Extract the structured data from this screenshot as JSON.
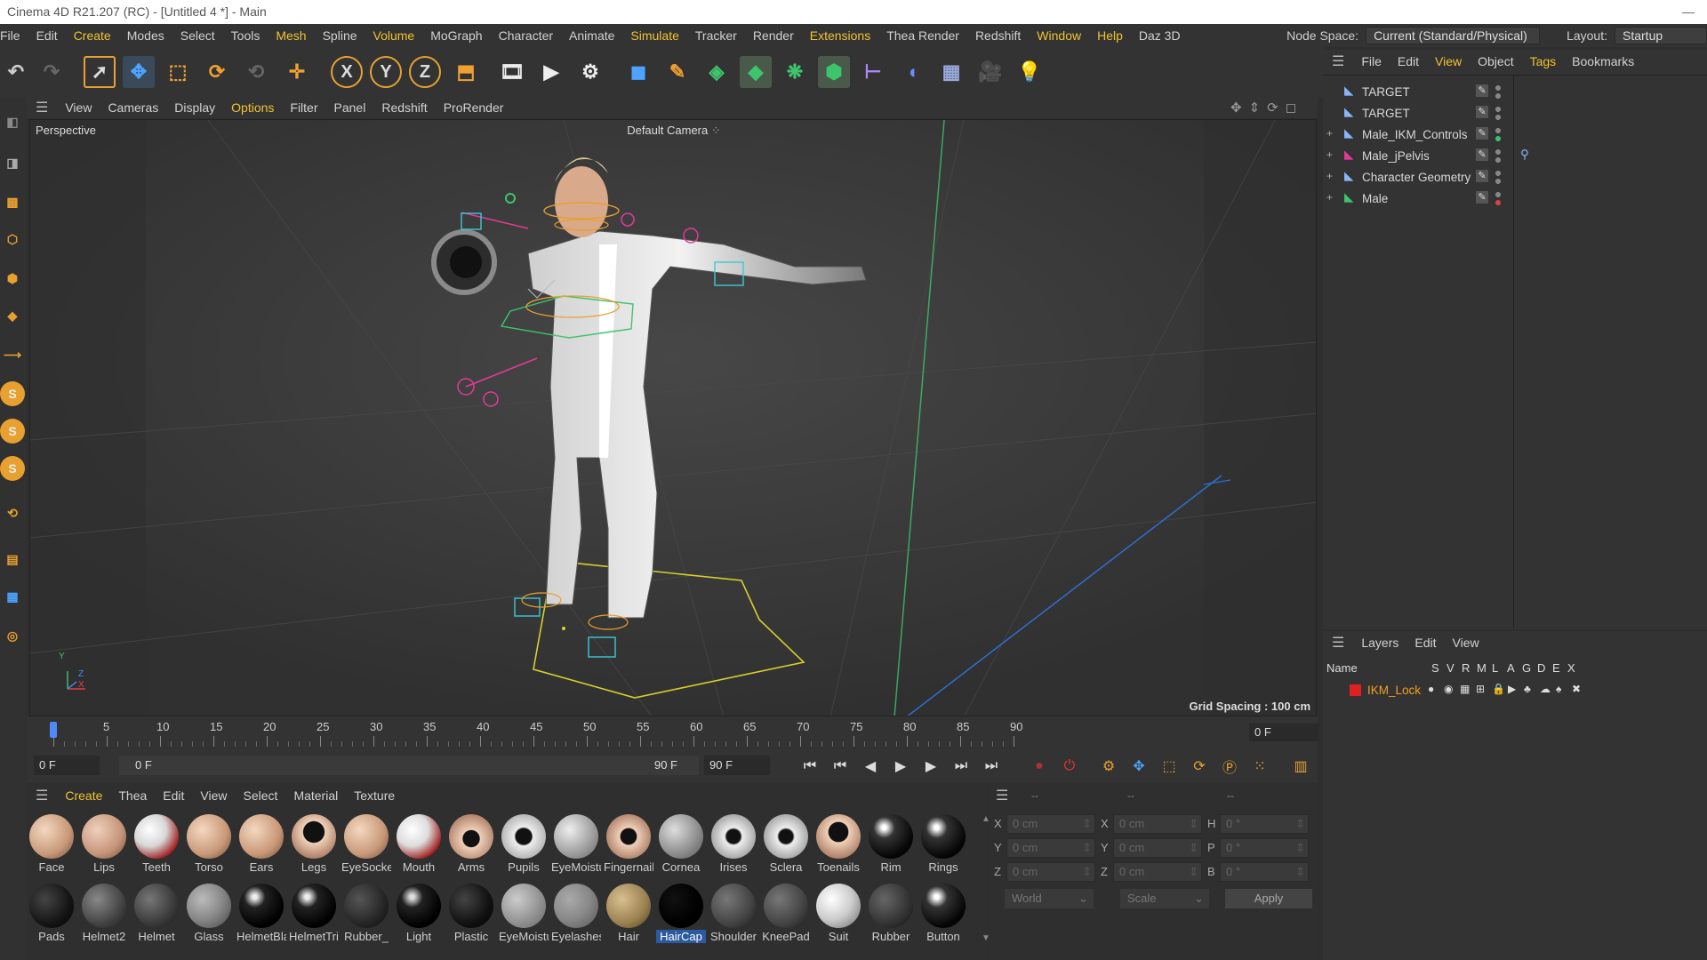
{
  "window": {
    "title": "Cinema 4D R21.207 (RC) - [Untitled 4 *] - Main",
    "minimize": "—"
  },
  "menu": [
    "File",
    "Edit",
    "Create",
    "Modes",
    "Select",
    "Tools",
    "Mesh",
    "Spline",
    "Volume",
    "MoGraph",
    "Character",
    "Animate",
    "Simulate",
    "Tracker",
    "Render",
    "Extensions",
    "Thea Render",
    "Redshift",
    "Window",
    "Help",
    "Daz 3D"
  ],
  "menu_highlight": [
    "Create",
    "Mesh",
    "Volume",
    "Simulate",
    "Extensions",
    "Window",
    "Help"
  ],
  "nodespace": {
    "label": "Node Space:",
    "value": "Current (Standard/Physical)",
    "layout_label": "Layout:",
    "layout_value": "Startup"
  },
  "viewport": {
    "menu": [
      "View",
      "Cameras",
      "Display",
      "Options",
      "Filter",
      "Panel",
      "Redshift",
      "ProRender"
    ],
    "menu_highlight": "Options",
    "label": "Perspective",
    "camera": "Default Camera",
    "grid_spacing": "Grid Spacing : 100 cm",
    "axis": {
      "y": "Y",
      "z": "Z",
      "x": "X"
    }
  },
  "timeline": {
    "ticks": [
      "0",
      "5",
      "10",
      "15",
      "20",
      "25",
      "30",
      "35",
      "40",
      "45",
      "50",
      "55",
      "60",
      "65",
      "70",
      "75",
      "80",
      "85",
      "90"
    ],
    "current_frame": "0 F"
  },
  "transport": {
    "start": "0 F",
    "range_start": "0 F",
    "range_end": "90 F",
    "end": "90 F"
  },
  "object_manager": {
    "menu": [
      "File",
      "Edit",
      "View",
      "Object",
      "Tags",
      "Bookmarks"
    ],
    "menu_highlight": [
      "View",
      "Tags"
    ],
    "objects": [
      {
        "name": "TARGET",
        "dot": "#888888",
        "expand": ""
      },
      {
        "name": "TARGET",
        "dot": "#888888",
        "expand": ""
      },
      {
        "name": "Male_IKM_Controls",
        "dot": "#3ec46d",
        "expand": "+"
      },
      {
        "name": "Male_jPelvis",
        "dot": "#888888",
        "expand": "+"
      },
      {
        "name": "Character Geometry",
        "dot": "#888888",
        "expand": "+"
      },
      {
        "name": "Male",
        "dot": "#e04040",
        "expand": "+"
      }
    ]
  },
  "layer_manager": {
    "menu": [
      "Layers",
      "Edit",
      "View"
    ],
    "columns": [
      "Name",
      "S",
      "V",
      "R",
      "M",
      "L",
      "A",
      "G",
      "D",
      "E",
      "X"
    ],
    "layers": [
      {
        "name": "IKM_Lock",
        "color": "#e02020"
      }
    ]
  },
  "material_manager": {
    "menu": [
      "Create",
      "Thea",
      "Edit",
      "View",
      "Select",
      "Material",
      "Texture"
    ],
    "menu_highlight": "Create",
    "row1": [
      {
        "name": "Face",
        "bg": "radial-gradient(circle at 35% 35%,#f4d8c0,#c89878 60%,#6a4a38)"
      },
      {
        "name": "Lips",
        "bg": "radial-gradient(circle at 35% 35%,#f0d0bc,#c49478 60%,#6a4a38)"
      },
      {
        "name": "Teeth",
        "bg": "radial-gradient(circle at 35% 35%,#fff,#d8d8d8 40%,#a02020 75%,#400)"
      },
      {
        "name": "Torso",
        "bg": "radial-gradient(circle at 35% 35%,#f4d8c0,#c89878 60%,#6a4a38)"
      },
      {
        "name": "Ears",
        "bg": "radial-gradient(circle at 35% 35%,#f4d8c0,#c89878 60%,#6a4a38)"
      },
      {
        "name": "Legs",
        "bg": "radial-gradient(circle at 50% 40%,#111 30%,#f0d0b8 32%,#a87860 80%)"
      },
      {
        "name": "EyeSocket",
        "bg": "radial-gradient(circle at 35% 35%,#f4d8c0,#c89878 60%,#6a4a38)"
      },
      {
        "name": "Mouth",
        "bg": "radial-gradient(circle at 35% 35%,#fff,#ddd 40%,#a02020 75%,#400)"
      },
      {
        "name": "Arms",
        "bg": "radial-gradient(circle at 50% 55%,#111 25%,#f0d0b8 27%,#a87860 80%)"
      },
      {
        "name": "Pupils",
        "bg": "radial-gradient(circle at 50% 50%,#111 25%,#eee 30%,#aaa 80%)"
      },
      {
        "name": "EyeMoisture",
        "bg": "radial-gradient(circle at 35% 35%,#eee,#aaa 50%,#666)"
      },
      {
        "name": "Fingernails",
        "bg": "radial-gradient(circle at 50% 50%,#111 25%,#f0d0b8 28%,#a87860 80%)"
      },
      {
        "name": "Cornea",
        "bg": "radial-gradient(circle at 35% 35%,#ddd,#999 50%,#555)"
      },
      {
        "name": "Irises",
        "bg": "radial-gradient(circle at 50% 50%,#111 22%,#eee 28%,#999 80%)"
      },
      {
        "name": "Sclera",
        "bg": "radial-gradient(circle at 50% 50%,#111 22%,#eee 28%,#999 80%)"
      },
      {
        "name": "Toenails",
        "bg": "radial-gradient(circle at 50% 40%,#111 28%,#f0d0b8 30%,#a87860 80%)"
      },
      {
        "name": "Rim",
        "bg": "radial-gradient(circle at 35% 30%,#fff 5%,#333 25%,#050505 70%)"
      },
      {
        "name": "Rings",
        "bg": "radial-gradient(circle at 35% 30%,#fff 5%,#333 25%,#050505 70%)"
      }
    ],
    "row2": [
      {
        "name": "Pads",
        "bg": "radial-gradient(circle at 35% 35%,#444,#151515 60%,#000)"
      },
      {
        "name": "Helmet2",
        "bg": "radial-gradient(circle at 35% 35%,#888,#444 60%,#1a1a1a)"
      },
      {
        "name": "Helmet",
        "bg": "radial-gradient(circle at 35% 35%,#777,#3a3a3a 60%,#151515)"
      },
      {
        "name": "Glass",
        "bg": "radial-gradient(circle at 35% 35%,#bbb,#888 50%,#444)"
      },
      {
        "name": "HelmetBlack",
        "bg": "radial-gradient(circle at 35% 30%,#eee 5%,#222 25%,#000 70%)"
      },
      {
        "name": "HelmetTrim",
        "bg": "radial-gradient(circle at 35% 30%,#eee 5%,#222 25%,#000 70%)"
      },
      {
        "name": "Rubber_",
        "bg": "radial-gradient(circle at 35% 35%,#555,#262626 60%,#0a0a0a)"
      },
      {
        "name": "Light",
        "bg": "radial-gradient(circle at 35% 30%,#ddd 5%,#222 25%,#000 70%)"
      },
      {
        "name": "Plastic",
        "bg": "radial-gradient(circle at 35% 35%,#444,#111 60%,#000)"
      },
      {
        "name": "EyeMoisture",
        "bg": "radial-gradient(circle at 35% 35%,#ccc,#999 50%,#666)"
      },
      {
        "name": "Eyelashes",
        "bg": "radial-gradient(circle at 35% 35%,#aaa,#888 50%,#555)"
      },
      {
        "name": "Hair",
        "bg": "radial-gradient(circle at 35% 35%,#d8c090,#9a8050 60%,#4a3a20)"
      },
      {
        "name": "HairCap",
        "bg": "radial-gradient(circle at 35% 35%,#111,#000 60%,#000)"
      },
      {
        "name": "Shoulder",
        "bg": "radial-gradient(circle at 35% 35%,#777,#444 60%,#1a1a1a)"
      },
      {
        "name": "KneePad",
        "bg": "radial-gradient(circle at 35% 35%,#777,#444 60%,#1a1a1a)"
      },
      {
        "name": "Suit",
        "bg": "radial-gradient(circle at 35% 35%,#fff,#ccc 50%,#666)"
      },
      {
        "name": "Rubber",
        "bg": "radial-gradient(circle at 35% 35%,#666,#333 60%,#111)"
      },
      {
        "name": "Button",
        "bg": "radial-gradient(circle at 35% 30%,#fff 5%,#333 25%,#050505 70%)"
      }
    ],
    "selected": "HairCap"
  },
  "coordinates": {
    "header": "--",
    "rows": [
      {
        "a": "X",
        "av": "0 cm",
        "b": "X",
        "bv": "0 cm",
        "c": "H",
        "cv": "0 °"
      },
      {
        "a": "Y",
        "av": "0 cm",
        "b": "Y",
        "bv": "0 cm",
        "c": "P",
        "cv": "0 °"
      },
      {
        "a": "Z",
        "av": "0 cm",
        "b": "Z",
        "bv": "0 cm",
        "c": "B",
        "cv": "0 °"
      }
    ],
    "world": "World",
    "scale": "Scale",
    "apply": "Apply"
  }
}
